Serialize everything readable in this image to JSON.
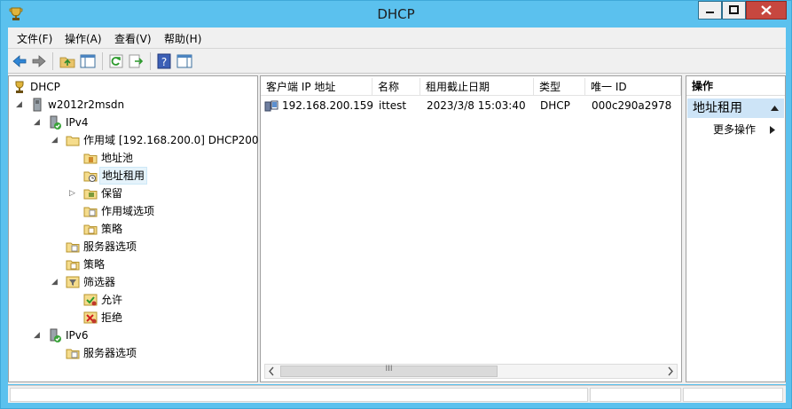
{
  "window": {
    "title": "DHCP"
  },
  "menubar": {
    "items": [
      {
        "label": "文件(F)"
      },
      {
        "label": "操作(A)"
      },
      {
        "label": "查看(V)"
      },
      {
        "label": "帮助(H)"
      }
    ]
  },
  "tree": {
    "root": "DHCP",
    "server": "w2012r2msdn",
    "ipv4": "IPv4",
    "scope": "作用域 [192.168.200.0] DHCP200",
    "address_pool": "地址池",
    "address_leases": "地址租用",
    "reservations": "保留",
    "scope_options": "作用域选项",
    "scope_policies": "策略",
    "server_options": "服务器选项",
    "policies": "策略",
    "filters": "筛选器",
    "allow": "允许",
    "deny": "拒绝",
    "ipv6": "IPv6",
    "ipv6_server_options": "服务器选项"
  },
  "list": {
    "columns": [
      "客户端 IP 地址",
      "名称",
      "租用截止日期",
      "类型",
      "唯一 ID"
    ],
    "rows": [
      {
        "ip": "192.168.200.159",
        "name": "ittest",
        "expiry": "2023/3/8 15:03:40",
        "type": "DHCP",
        "uid": "000c290a2978"
      }
    ],
    "scroll_glyph": "III"
  },
  "actions": {
    "header": "操作",
    "section": "地址租用",
    "more": "更多操作"
  },
  "colors": {
    "title_bar": "#5bc1ee",
    "selection": "#e5f3fb",
    "action_section": "#cde4f7"
  }
}
